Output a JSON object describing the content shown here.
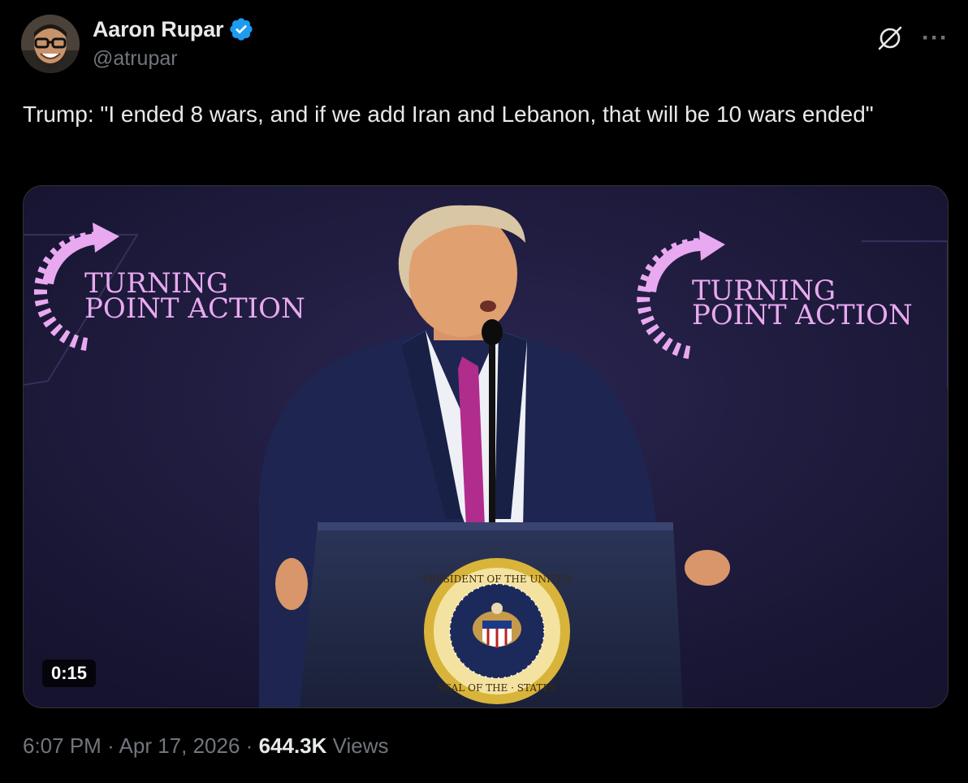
{
  "author": {
    "name": "Aaron Rupar",
    "handle": "@atrupar",
    "verified": true,
    "verified_color": "#1d9bf0"
  },
  "actions": {
    "grok_icon": "grok-icon",
    "more_label": "···"
  },
  "tweet": {
    "text": "Trump: \"I ended 8 wars, and if we add Iran and Lebanon, that will be 10 wars ended\""
  },
  "media": {
    "type": "video",
    "duration": "0:15",
    "banner_left_line1": "TURNING",
    "banner_left_line2": "POINT ACTION",
    "banner_right_line1": "TURNING",
    "banner_right_line2": "POINT ACTION",
    "seal_text_top": "PRESIDENT OF THE UNITED",
    "seal_text_bottom": "SEAL OF THE · STATES"
  },
  "meta": {
    "time": "6:07 PM",
    "separator": "·",
    "date": "Apr 17, 2026",
    "views_count": "644.3K",
    "views_label": "Views"
  },
  "colors": {
    "background": "#000000",
    "text_primary": "#e7e9ea",
    "text_secondary": "#71767b",
    "stage_background": "#1c1a3a",
    "banner_pink": "#e9a9f0",
    "seal_gold": "#d9b43a"
  }
}
